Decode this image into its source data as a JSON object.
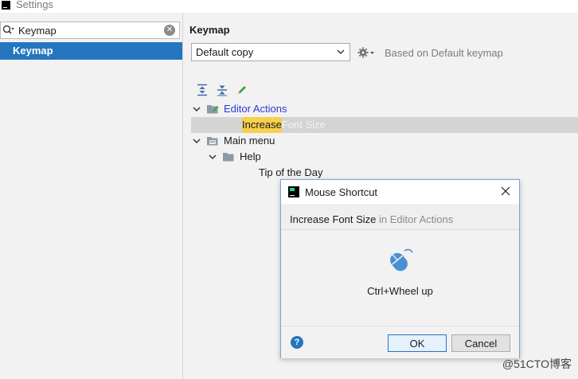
{
  "window": {
    "title": "Settings",
    "app_icon": "pycharm-icon"
  },
  "left": {
    "search": {
      "value": "Keymap",
      "icon": "search-icon",
      "clear_icon": "clear-icon"
    },
    "selected_item": "Keymap"
  },
  "right": {
    "title": "Keymap",
    "keymap_select": {
      "value": "Default copy"
    },
    "based_on": "Based on Default keymap",
    "toolbar": [
      "expand-all-icon",
      "collapse-all-icon",
      "edit-icon"
    ],
    "tree": {
      "editor_actions": "Editor Actions",
      "increase_hl": "Increase",
      "increase_rest": " Font Size",
      "main_menu": "Main menu",
      "help": "Help",
      "tip": "Tip of the Day"
    }
  },
  "dialog": {
    "title": "Mouse Shortcut",
    "action": "Increase Font Size",
    "context": " in Editor Actions",
    "shortcut": "Ctrl+Wheel up",
    "ok": "OK",
    "cancel": "Cancel",
    "help": "?"
  },
  "watermark": "@51CTO博客",
  "colors": {
    "selection_blue": "#2675bf",
    "editor_actions_blue": "#2b39d8",
    "highlight_yellow": "#f6d04e",
    "mouse_blue": "#4a8fd4"
  }
}
